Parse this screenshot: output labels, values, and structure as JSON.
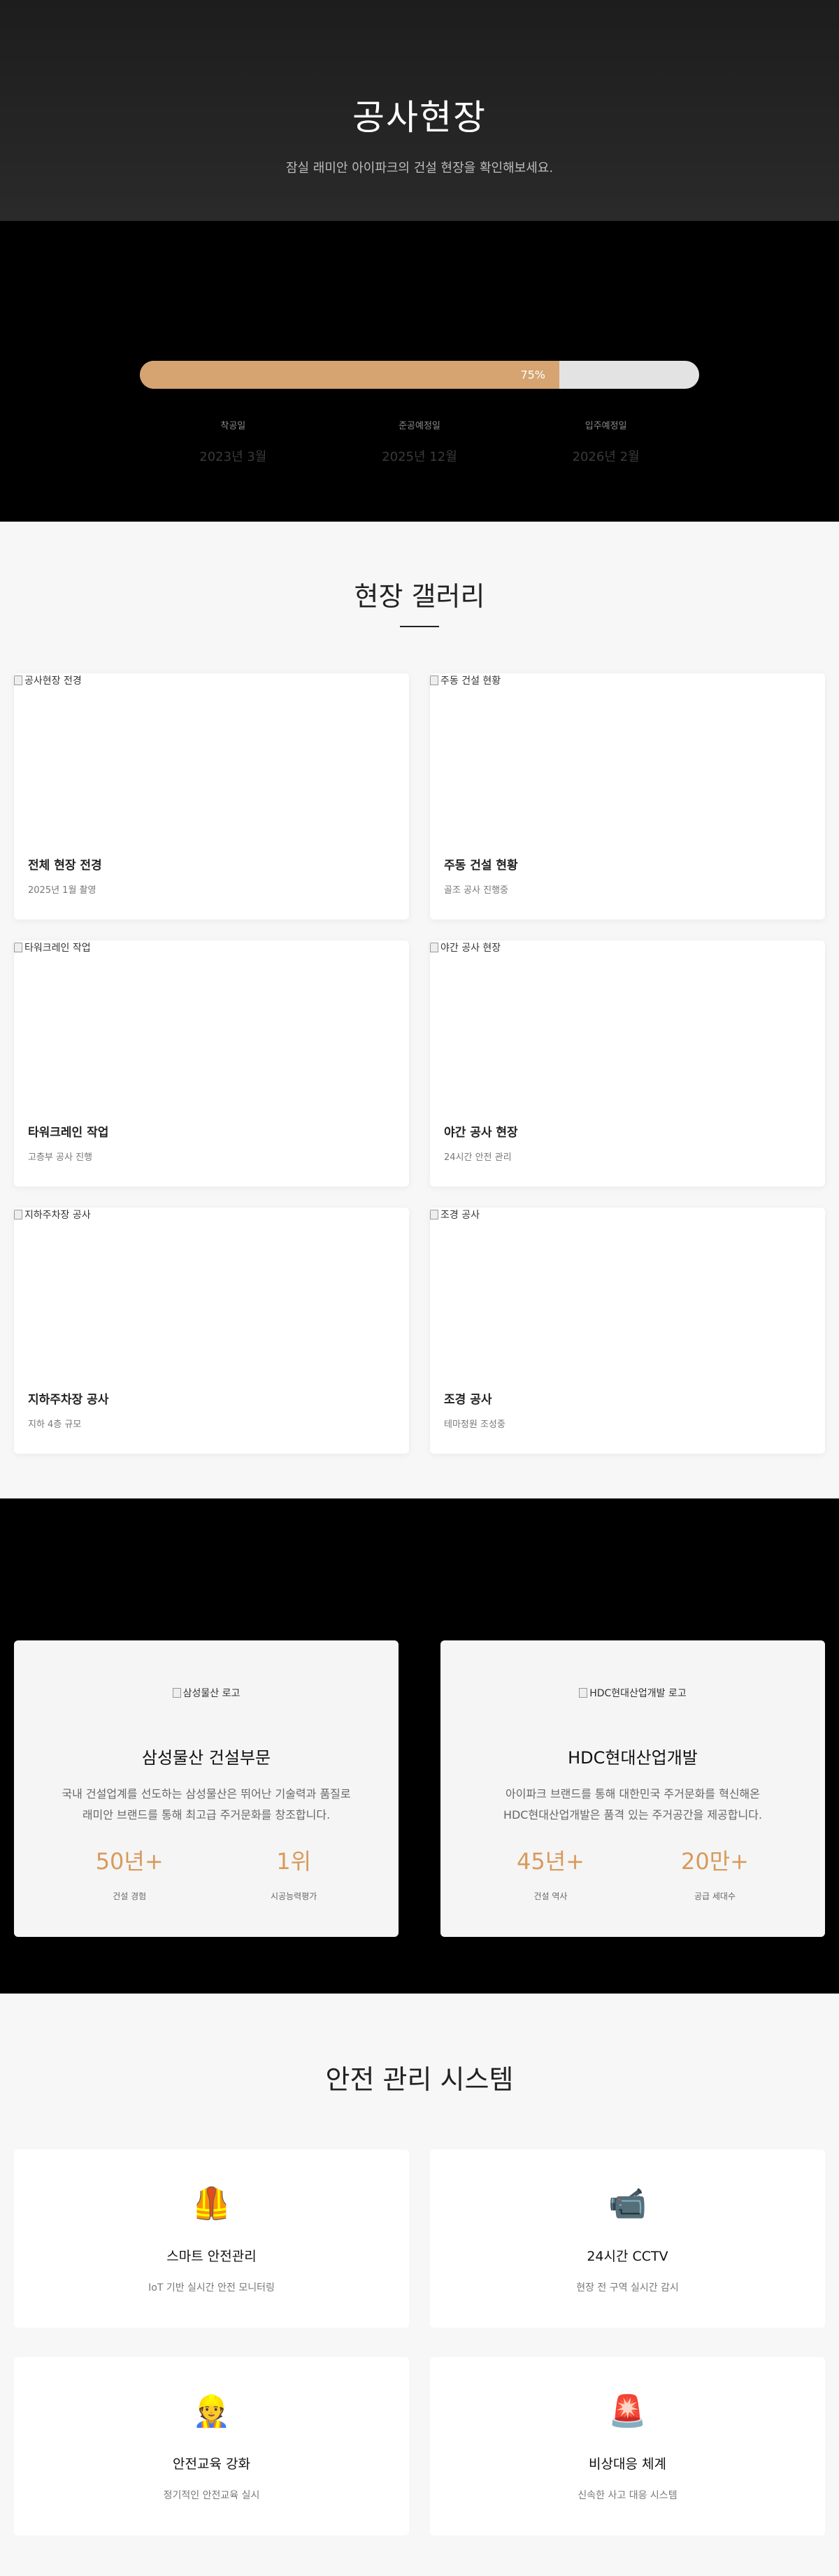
{
  "hero": {
    "title": "공사현장",
    "subtitle": "잠실 래미안 아이파크의 건설 현장을 확인해보세요."
  },
  "progress": {
    "percent": 75,
    "percent_label": "75%",
    "milestones": [
      {
        "label": "착공일",
        "date": "2023년 3월"
      },
      {
        "label": "준공예정일",
        "date": "2025년 12월"
      },
      {
        "label": "입주예정일",
        "date": "2026년 2월"
      }
    ],
    "colors": {
      "fill": "#d5a471",
      "track": "#e3e3e3"
    }
  },
  "gallery": {
    "title": "현장 갤러리",
    "items": [
      {
        "alt": "공사현장 전경",
        "title": "전체 현장 전경",
        "sub": "2025년 1월 촬영"
      },
      {
        "alt": "주동 건설 현황",
        "title": "주동 건설 현황",
        "sub": "골조 공사 진행중"
      },
      {
        "alt": "타워크레인 작업",
        "title": "타워크레인 작업",
        "sub": "고층부 공사 진행"
      },
      {
        "alt": "야간 공사 현장",
        "title": "야간 공사 현장",
        "sub": "24시간 안전 관리"
      },
      {
        "alt": "지하주차장 공사",
        "title": "지하주차장 공사",
        "sub": "지하 4층 규모"
      },
      {
        "alt": "조경 공사",
        "title": "조경 공사",
        "sub": "테마정원 조성중"
      }
    ]
  },
  "partners": [
    {
      "logo_alt": "삼성물산 로고",
      "name": "삼성물산 건설부문",
      "desc": [
        "국내 건설업계를 선도하는 삼성물산은 뛰어난 기술력과 품질로",
        "래미안 브랜드를 통해 최고급 주거문화를 창조합니다."
      ],
      "stats": [
        {
          "num": "50년+",
          "label": "건설 경험"
        },
        {
          "num": "1위",
          "label": "시공능력평가"
        }
      ]
    },
    {
      "logo_alt": "HDC현대산업개발 로고",
      "name": "HDC현대산업개발",
      "desc": [
        "아이파크 브랜드를 통해 대한민국 주거문화를 혁신해온",
        "HDC현대산업개발은 품격 있는 주거공간을 제공합니다."
      ],
      "stats": [
        {
          "num": "45년+",
          "label": "건설 역사"
        },
        {
          "num": "20만+",
          "label": "공급 세대수"
        }
      ]
    }
  ],
  "safety": {
    "title": "안전 관리 시스템",
    "items": [
      {
        "icon": "🦺",
        "icon_name": "safety-vest-icon",
        "title": "스마트 안전관리",
        "desc": "IoT 기반 실시간 안전 모니터링"
      },
      {
        "icon": "📹",
        "icon_name": "video-camera-icon",
        "title": "24시간 CCTV",
        "desc": "현장 전 구역 실시간 감시"
      },
      {
        "icon": "👷",
        "icon_name": "construction-worker-icon",
        "title": "안전교육 강화",
        "desc": "정기적인 안전교육 실시"
      },
      {
        "icon": "🚨",
        "icon_name": "siren-icon",
        "title": "비상대응 체계",
        "desc": "신속한 사고 대응 시스템"
      }
    ]
  }
}
